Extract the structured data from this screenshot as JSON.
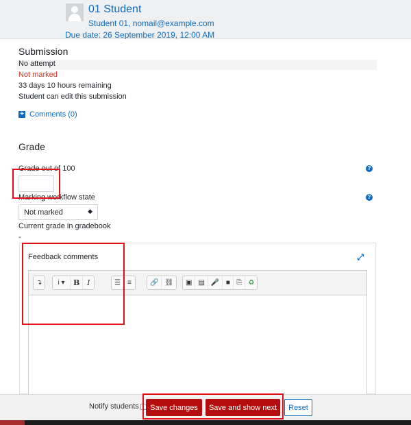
{
  "header": {
    "student_name": "01 Student",
    "student_email": "Student 01, nomail@example.com",
    "due_date": "Due date: 26 September 2019, 12:00 AM"
  },
  "submission": {
    "title": "Submission",
    "attempt_status": "No attempt",
    "grading_status": "Not marked",
    "time_remaining": "33 days 10 hours remaining",
    "edit_status": "Student can edit this submission",
    "comments_link": "Comments (0)"
  },
  "grade": {
    "title": "Grade",
    "grade_label": "Grade out of 100",
    "grade_value": "",
    "workflow_label": "Marking workflow state",
    "workflow_selected": "Not marked",
    "current_grade_label": "Current grade in gradebook",
    "current_grade_value": "-"
  },
  "feedback": {
    "title": "Feedback comments",
    "toolbar": {
      "collapse": "↴",
      "info": "i ▾",
      "bold": "B",
      "italic": "I",
      "bulleted_list": "☰",
      "numbered_list": "≡",
      "link": "🔗",
      "unlink": "⛓",
      "image": "▣",
      "media": "▤",
      "audio": "🎤",
      "video": "■",
      "manage_files": "⎘",
      "recycle": "♻"
    }
  },
  "footer": {
    "notify_label": "Notify students",
    "save_changes": "Save changes",
    "save_and_show_next": "Save and show next",
    "reset": "Reset"
  },
  "colors": {
    "link": "#0f6cbf",
    "error": "#ca3120",
    "primary_button": "#b50d0d",
    "annotation": "#e0101a"
  }
}
